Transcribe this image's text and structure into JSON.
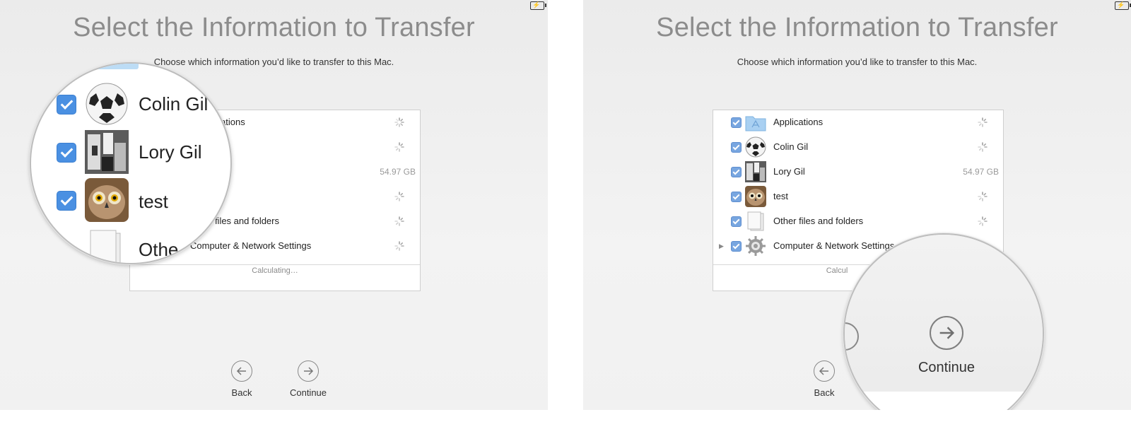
{
  "left_panel": {
    "title": "Select the Information to Transfer",
    "subtitle": "Choose which information you’d like to transfer to this Mac.",
    "items": [
      {
        "label": "Applications",
        "icon": "folder-icon",
        "size": "",
        "loading": true
      },
      {
        "label": "",
        "icon": "user-icon",
        "size": "",
        "loading": true
      },
      {
        "label": "",
        "icon": "user-icon",
        "size": "54.97 GB",
        "loading": false
      },
      {
        "label": "",
        "icon": "user-icon",
        "size": "",
        "loading": true
      },
      {
        "label": "Other files and folders",
        "icon": "documents-icon",
        "size": "",
        "loading": true
      },
      {
        "label": "Computer & Network Settings",
        "icon": "gear-icon",
        "size": "",
        "loading": true
      }
    ],
    "visible_fragments": {
      "applications": "ations",
      "other_files": "r files and folders"
    },
    "status": "Calculating…",
    "back_label": "Back",
    "continue_label": "Continue",
    "magnifier": {
      "items": [
        {
          "label": "Colin Gil",
          "icon": "soccer-ball-avatar"
        },
        {
          "label": "Lory  Gil",
          "icon": "photo-avatar"
        },
        {
          "label": "test",
          "icon": "owl-avatar"
        },
        {
          "label": "Othe",
          "icon": "documents-icon"
        }
      ]
    }
  },
  "right_panel": {
    "title": "Select the Information to Transfer",
    "subtitle": "Choose which information you’d like to transfer to this Mac.",
    "items": [
      {
        "label": "Applications",
        "icon": "folder-icon",
        "size": "",
        "loading": true
      },
      {
        "label": "Colin Gil",
        "icon": "soccer-ball-avatar",
        "size": "",
        "loading": true
      },
      {
        "label": "Lory  Gil",
        "icon": "photo-avatar",
        "size": "54.97 GB",
        "loading": false
      },
      {
        "label": "test",
        "icon": "owl-avatar",
        "size": "",
        "loading": true
      },
      {
        "label": "Other files and folders",
        "icon": "documents-icon",
        "size": "",
        "loading": true
      },
      {
        "label": "Computer & Network Settings",
        "icon": "gear-icon",
        "size": "",
        "loading": true
      }
    ],
    "status": "Calcul",
    "back_label": "Back",
    "continue_label": "Continue",
    "magnifier": {
      "continue_label": "Continue"
    }
  },
  "colors": {
    "accent": "#4a90e2",
    "title_gray": "#8c8c8c",
    "checkbox": "#78a6e0"
  }
}
